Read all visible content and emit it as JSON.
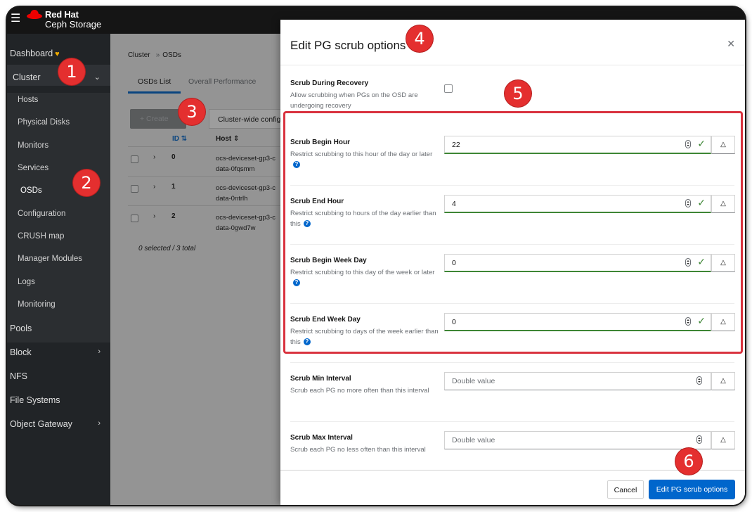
{
  "brand": {
    "line1": "Red Hat",
    "line2": "Ceph Storage"
  },
  "sidebar": {
    "dashboard": "Dashboard",
    "cluster": "Cluster",
    "items": [
      "Hosts",
      "Physical Disks",
      "Monitors",
      "Services",
      "OSDs",
      "Configuration",
      "CRUSH map",
      "Manager Modules",
      "Logs",
      "Monitoring"
    ],
    "pools": "Pools",
    "block": "Block",
    "nfs": "NFS",
    "file_systems": "File Systems",
    "object_gateway": "Object Gateway"
  },
  "breadcrumb": {
    "root": "Cluster",
    "current": "OSDs"
  },
  "tabs": {
    "active": "OSDs List",
    "second": "Overall Performance"
  },
  "toolbar": {
    "create": "+ Create",
    "config": "Cluster-wide config"
  },
  "table": {
    "col_id": "ID",
    "col_host": "Host",
    "rows": [
      {
        "id": "0",
        "host": "ocs-deviceset-gp3-c data-0fqsmm"
      },
      {
        "id": "1",
        "host": "ocs-deviceset-gp3-c data-0ntrlh"
      },
      {
        "id": "2",
        "host": "ocs-deviceset-gp3-c data-0gwd7w"
      }
    ],
    "selection": "0 selected / 3 total"
  },
  "modal": {
    "title": "Edit PG scrub options",
    "recovery": {
      "label": "Scrub During Recovery",
      "help": "Allow scrubbing when PGs on the OSD are undergoing recovery"
    },
    "begin_hour": {
      "label": "Scrub Begin Hour",
      "help": "Restrict scrubbing to this hour of the day or later",
      "value": "22"
    },
    "end_hour": {
      "label": "Scrub End Hour",
      "help": "Restrict scrubbing to hours of the day earlier than this",
      "value": "4"
    },
    "begin_week": {
      "label": "Scrub Begin Week Day",
      "help": "Restrict scrubbing to this day of the week or later",
      "value": "0"
    },
    "end_week": {
      "label": "Scrub End Week Day",
      "help": "Restrict scrubbing to days of the week earlier than this",
      "value": "0"
    },
    "min_interval": {
      "label": "Scrub Min Interval",
      "help": "Scrub each PG no more often than this interval",
      "placeholder": "Double value"
    },
    "max_interval": {
      "label": "Scrub Max Interval",
      "help": "Scrub each PG no less often than this interval",
      "placeholder": "Double value"
    },
    "cancel": "Cancel",
    "submit": "Edit PG scrub options"
  },
  "markers": [
    "1",
    "2",
    "3",
    "4",
    "5",
    "6"
  ],
  "colors": {
    "accent": "#0066cc",
    "valid": "#3e8635",
    "marker": "#e42f2f"
  }
}
